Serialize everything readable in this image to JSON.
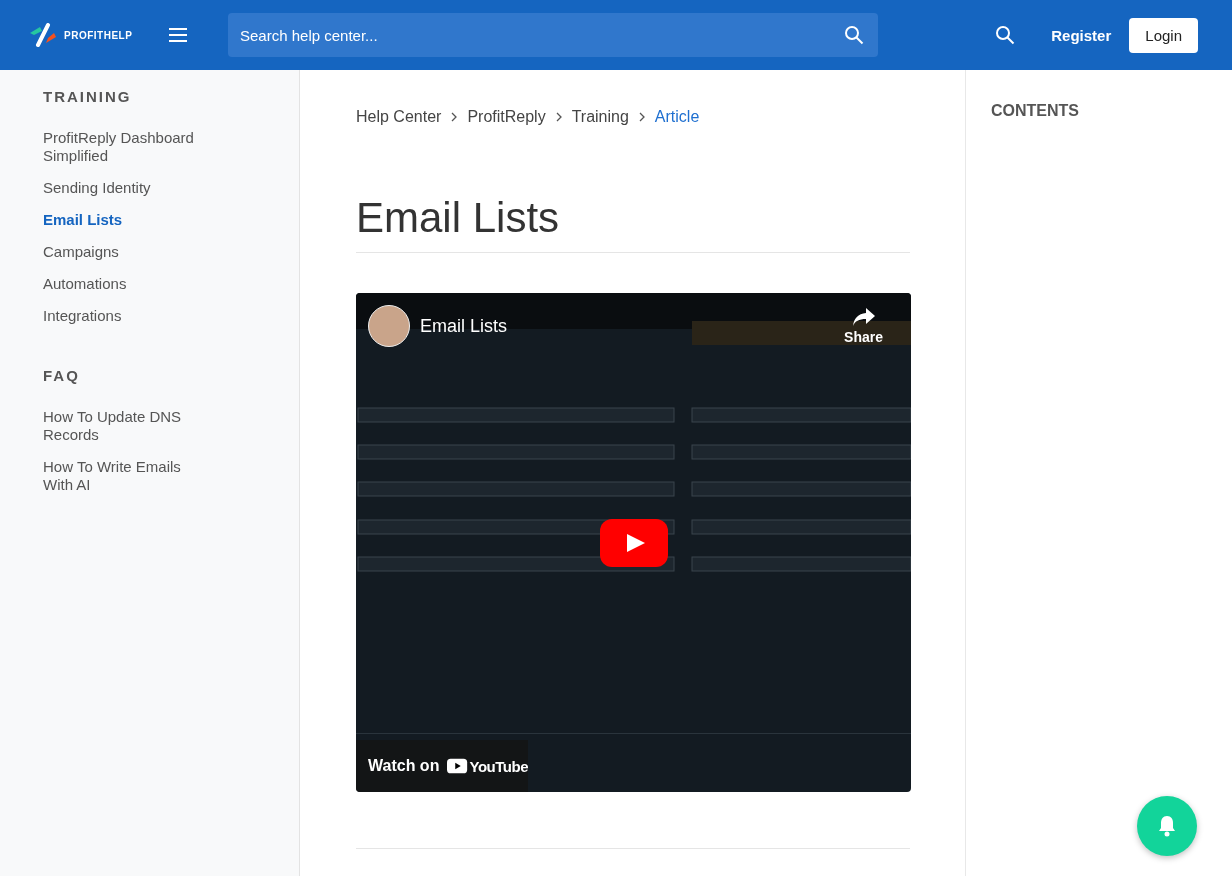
{
  "header": {
    "logo_text": "PROFITHELP",
    "search": {
      "placeholder": "Search help center..."
    },
    "register": "Register",
    "login": "Login"
  },
  "sidebar": {
    "sections": [
      {
        "title": "TRAINING",
        "items": [
          {
            "label": "ProfitReply Dashboard Simplified",
            "selected": false
          },
          {
            "label": "Sending Identity",
            "selected": false
          },
          {
            "label": "Email Lists",
            "selected": true
          },
          {
            "label": "Campaigns",
            "selected": false
          },
          {
            "label": "Automations",
            "selected": false
          },
          {
            "label": "Integrations",
            "selected": false
          }
        ]
      },
      {
        "title": "FAQ",
        "items": [
          {
            "label": "How To Update DNS Records",
            "selected": false
          },
          {
            "label": "How To Write Emails With AI",
            "selected": false
          }
        ]
      }
    ]
  },
  "breadcrumb": [
    {
      "label": "Help Center",
      "current": false
    },
    {
      "label": "ProfitReply",
      "current": false
    },
    {
      "label": "Training",
      "current": false
    },
    {
      "label": "Article",
      "current": true
    }
  ],
  "article": {
    "title": "Email Lists",
    "video": {
      "kind": "picture",
      "title": "Email Lists",
      "share": "Share",
      "watch_on": "Watch on",
      "brand": "YouTube"
    }
  },
  "contents": {
    "title": "CONTENTS"
  }
}
